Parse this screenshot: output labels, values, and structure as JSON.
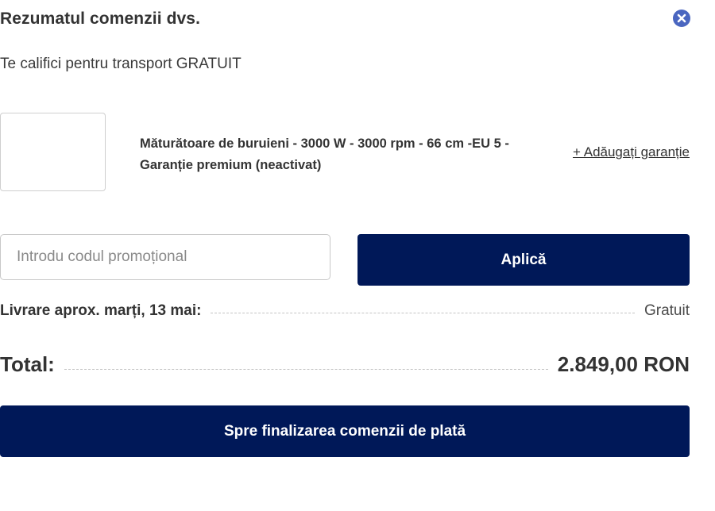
{
  "summary": {
    "title": "Rezumatul comenzii dvs.",
    "close_icon": "close-icon",
    "shipping_note": "Te califici pentru transport GRATUIT"
  },
  "product": {
    "name": "Măturătoare de buruieni - 3000 W - 3000 rpm - 66 cm -EU 5 - Garanție premium (neactivat)",
    "add_warranty_label": "+ Adăugați garanție"
  },
  "promo": {
    "placeholder": "Introdu codul promoțional",
    "value": "",
    "apply_label": "Aplică"
  },
  "delivery": {
    "label": "Livrare aprox. marți, 13 mai:",
    "value": "Gratuit"
  },
  "total": {
    "label": "Total:",
    "value": "2.849,00 RON"
  },
  "checkout": {
    "label": "Spre finalizarea comenzii de plată"
  },
  "colors": {
    "primary_button": "#001858",
    "close_icon": "#4a66c0",
    "text": "#333333"
  }
}
